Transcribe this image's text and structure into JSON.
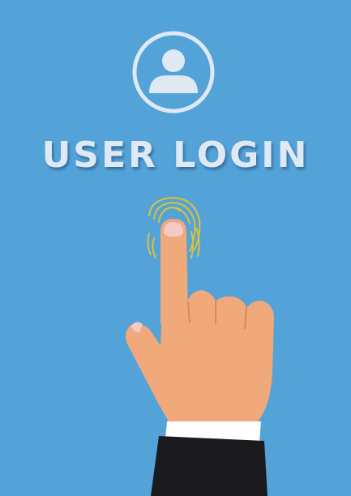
{
  "title": "USER LOGIN",
  "icons": {
    "avatar": "user-avatar-icon",
    "fingerprint": "fingerprint-icon",
    "hand": "pointing-hand"
  },
  "colors": {
    "background": "#53a3d9",
    "icon": "#dfe9f4",
    "skin": "#f0a97a",
    "fingerprint": "#d9c23a",
    "sleeve": "#1b1b1f",
    "cuff": "#ffffff"
  }
}
